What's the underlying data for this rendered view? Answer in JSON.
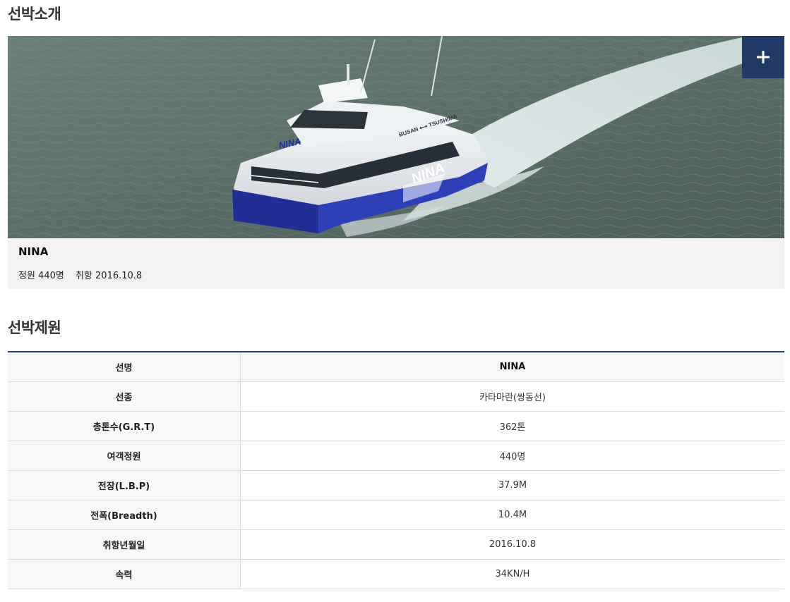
{
  "intro": {
    "title": "선박소개",
    "expand_icon": "plus-icon",
    "ship": {
      "name": "NINA",
      "capacity": "정원 440명",
      "service": "취항 2016.10.8",
      "hull_texts": {
        "logo_front": "NINA",
        "logo_side": "NINA",
        "route": "BUSAN ⟷ TSUSHIMA"
      }
    }
  },
  "specs": {
    "title": "선박제원",
    "rows": [
      {
        "label": "선명",
        "value": "NINA"
      },
      {
        "label": "선종",
        "value": "카타마란(쌍동선)"
      },
      {
        "label": "총톤수(G.R.T)",
        "value": "362톤"
      },
      {
        "label": "여객정원",
        "value": "440명"
      },
      {
        "label": "전장(L.B.P)",
        "value": "37.9M"
      },
      {
        "label": "전폭(Breadth)",
        "value": "10.4M"
      },
      {
        "label": "취항년월일",
        "value": "2016.10.8"
      },
      {
        "label": "속력",
        "value": "34KN/H"
      }
    ]
  },
  "colors": {
    "accent": "#1f3a66",
    "table_top_border": "#23408a",
    "card_background": "#f2f2f2",
    "sea": "#5b7269"
  }
}
